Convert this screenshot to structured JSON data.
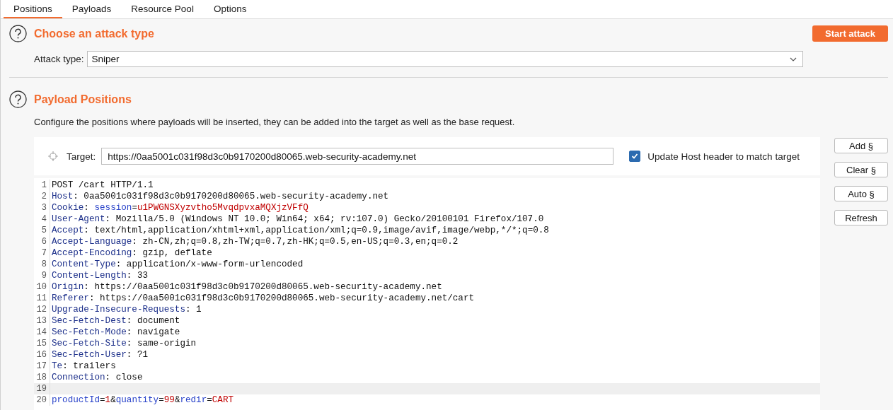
{
  "tabs": [
    {
      "label": "Positions",
      "selected": true
    },
    {
      "label": "Payloads",
      "selected": false
    },
    {
      "label": "Resource Pool",
      "selected": false
    },
    {
      "label": "Options",
      "selected": false
    }
  ],
  "attack_section": {
    "title": "Choose an attack type",
    "start_button": "Start attack",
    "attack_type_label": "Attack type:",
    "attack_type_value": "Sniper"
  },
  "positions_section": {
    "title": "Payload Positions",
    "description": "Configure the positions where payloads will be inserted, they can be added into the target as well as the base request.",
    "target_label": "Target:",
    "target_value": "https://0aa5001c031f98d3c0b9170200d80065.web-security-academy.net",
    "update_host": {
      "label": "Update Host header to match target",
      "checked": true
    },
    "buttons": [
      "Add §",
      "Clear §",
      "Auto §",
      "Refresh"
    ],
    "lines": [
      {
        "number": "1",
        "current": false,
        "tokens": [
          {
            "kind": "plain",
            "text": "POST /cart HTTP/1.1"
          }
        ]
      },
      {
        "number": "2",
        "current": false,
        "tokens": [
          {
            "kind": "name",
            "text": "Host"
          },
          {
            "kind": "plain",
            "text": ": 0aa5001c031f98d3c0b9170200d80065.web-security-academy.net"
          }
        ]
      },
      {
        "number": "3",
        "current": false,
        "tokens": [
          {
            "kind": "name",
            "text": "Cookie"
          },
          {
            "kind": "plain",
            "text": ": "
          },
          {
            "kind": "param",
            "text": "session"
          },
          {
            "kind": "plain",
            "text": "="
          },
          {
            "kind": "value",
            "text": "u1PWGNSXyzvtho5MvqdpvxaMQXjzVFfQ"
          }
        ]
      },
      {
        "number": "4",
        "current": false,
        "tokens": [
          {
            "kind": "name",
            "text": "User-Agent"
          },
          {
            "kind": "plain",
            "text": ": Mozilla/5.0 (Windows NT 10.0; Win64; x64; rv:107.0) Gecko/20100101 Firefox/107.0"
          }
        ]
      },
      {
        "number": "5",
        "current": false,
        "tokens": [
          {
            "kind": "name",
            "text": "Accept"
          },
          {
            "kind": "plain",
            "text": ": text/html,application/xhtml+xml,application/xml;q=0.9,image/avif,image/webp,*/*;q=0.8"
          }
        ]
      },
      {
        "number": "6",
        "current": false,
        "tokens": [
          {
            "kind": "name",
            "text": "Accept-Language"
          },
          {
            "kind": "plain",
            "text": ": zh-CN,zh;q=0.8,zh-TW;q=0.7,zh-HK;q=0.5,en-US;q=0.3,en;q=0.2"
          }
        ]
      },
      {
        "number": "7",
        "current": false,
        "tokens": [
          {
            "kind": "name",
            "text": "Accept-Encoding"
          },
          {
            "kind": "plain",
            "text": ": gzip, deflate"
          }
        ]
      },
      {
        "number": "8",
        "current": false,
        "tokens": [
          {
            "kind": "name",
            "text": "Content-Type"
          },
          {
            "kind": "plain",
            "text": ": application/x-www-form-urlencoded"
          }
        ]
      },
      {
        "number": "9",
        "current": false,
        "tokens": [
          {
            "kind": "name",
            "text": "Content-Length"
          },
          {
            "kind": "plain",
            "text": ": 33"
          }
        ]
      },
      {
        "number": "10",
        "current": false,
        "tokens": [
          {
            "kind": "name",
            "text": "Origin"
          },
          {
            "kind": "plain",
            "text": ": https://0aa5001c031f98d3c0b9170200d80065.web-security-academy.net"
          }
        ]
      },
      {
        "number": "11",
        "current": false,
        "tokens": [
          {
            "kind": "name",
            "text": "Referer"
          },
          {
            "kind": "plain",
            "text": ": https://0aa5001c031f98d3c0b9170200d80065.web-security-academy.net/cart"
          }
        ]
      },
      {
        "number": "12",
        "current": false,
        "tokens": [
          {
            "kind": "name",
            "text": "Upgrade-Insecure-Requests"
          },
          {
            "kind": "plain",
            "text": ": 1"
          }
        ]
      },
      {
        "number": "13",
        "current": false,
        "tokens": [
          {
            "kind": "name",
            "text": "Sec-Fetch-Dest"
          },
          {
            "kind": "plain",
            "text": ": document"
          }
        ]
      },
      {
        "number": "14",
        "current": false,
        "tokens": [
          {
            "kind": "name",
            "text": "Sec-Fetch-Mode"
          },
          {
            "kind": "plain",
            "text": ": navigate"
          }
        ]
      },
      {
        "number": "15",
        "current": false,
        "tokens": [
          {
            "kind": "name",
            "text": "Sec-Fetch-Site"
          },
          {
            "kind": "plain",
            "text": ": same-origin"
          }
        ]
      },
      {
        "number": "16",
        "current": false,
        "tokens": [
          {
            "kind": "name",
            "text": "Sec-Fetch-User"
          },
          {
            "kind": "plain",
            "text": ": ?1"
          }
        ]
      },
      {
        "number": "17",
        "current": false,
        "tokens": [
          {
            "kind": "name",
            "text": "Te"
          },
          {
            "kind": "plain",
            "text": ": trailers"
          }
        ]
      },
      {
        "number": "18",
        "current": false,
        "tokens": [
          {
            "kind": "name",
            "text": "Connection"
          },
          {
            "kind": "plain",
            "text": ": close"
          }
        ]
      },
      {
        "number": "19",
        "current": true
      },
      {
        "number": "20",
        "current": false,
        "tokens": [
          {
            "kind": "param",
            "text": "productId"
          },
          {
            "kind": "plain",
            "text": "="
          },
          {
            "kind": "value",
            "text": "1"
          },
          {
            "kind": "plain",
            "text": "&"
          },
          {
            "kind": "param",
            "text": "quantity"
          },
          {
            "kind": "plain",
            "text": "="
          },
          {
            "kind": "value",
            "text": "99"
          },
          {
            "kind": "plain",
            "text": "&"
          },
          {
            "kind": "param",
            "text": "redir"
          },
          {
            "kind": "plain",
            "text": "="
          },
          {
            "kind": "value",
            "text": "CART"
          }
        ]
      }
    ]
  }
}
